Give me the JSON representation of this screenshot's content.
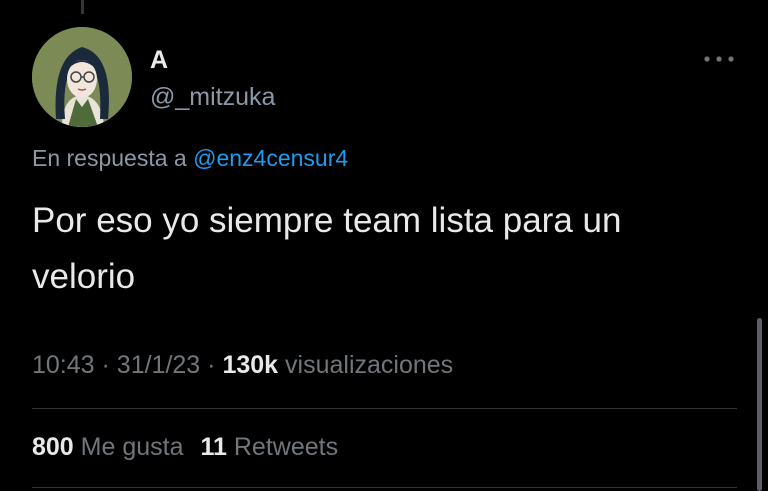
{
  "tweet": {
    "author": {
      "display_name": "A",
      "handle": "@_mitzuka"
    },
    "reply": {
      "prefix": "En respuesta a",
      "mention": "@enz4censur4"
    },
    "text": "Por eso yo siempre team lista para un velorio",
    "meta": {
      "time": "10:43",
      "date": "31/1/23",
      "views_count": "130k",
      "views_label": "visualizaciones"
    },
    "stats": {
      "likes_count": "800",
      "likes_label": "Me gusta",
      "retweets_count": "11",
      "retweets_label": "Retweets"
    }
  },
  "colors": {
    "accent": "#1d9bf0",
    "background": "#000000",
    "secondary_text": "#71767b"
  }
}
